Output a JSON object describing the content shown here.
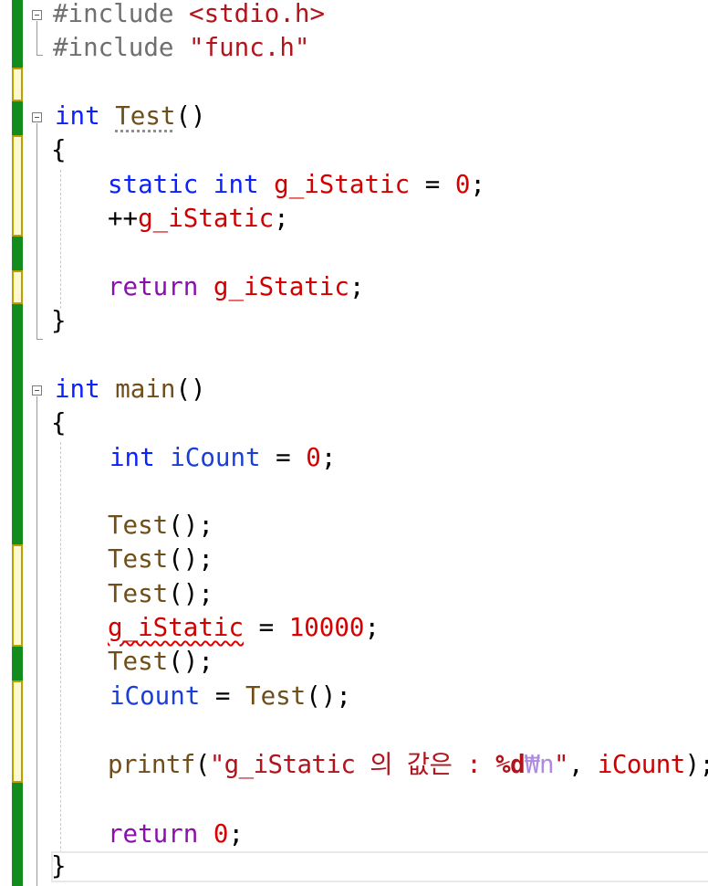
{
  "code": {
    "l01": {
      "hash": "#include",
      "space": " ",
      "path": "<stdio.h>"
    },
    "l02": {
      "hash": "#include",
      "space": " ",
      "path": "\"func.h\""
    },
    "l04": {
      "type": "int",
      "name": "Test",
      "parens": "()"
    },
    "l05": {
      "brace": "{"
    },
    "l06": {
      "static": "static",
      "int": "int",
      "var": "g_iStatic",
      "eq": " = ",
      "num": "0",
      "semi": ";"
    },
    "l07": {
      "op": "++",
      "var": "g_iStatic",
      "semi": ";"
    },
    "l09": {
      "ret": "return",
      "var": "g_iStatic",
      "semi": ";"
    },
    "l10": {
      "brace": "}"
    },
    "l12": {
      "type": "int",
      "name": "main",
      "parens": "()"
    },
    "l13": {
      "brace": "{"
    },
    "l14": {
      "int": "int",
      "var": "iCount",
      "eq": " = ",
      "num": "0",
      "semi": ";"
    },
    "l16": {
      "call": "Test",
      "tail": "();"
    },
    "l17": {
      "call": "Test",
      "tail": "();"
    },
    "l18": {
      "call": "Test",
      "tail": "();"
    },
    "l19": {
      "var": "g_iStatic",
      "eq": " = ",
      "num": "10000",
      "semi": ";"
    },
    "l20": {
      "call": "Test",
      "tail": "();"
    },
    "l21": {
      "var": "iCount",
      "eq": " = ",
      "call": "Test",
      "tail": "();"
    },
    "l23": {
      "fn": "printf",
      "open": "(",
      "str1": "\"g_iStatic 의 값은 : ",
      "fmt": "%d",
      "esc": "₩n",
      "str2": "\"",
      "comma": ", ",
      "var": "iCount",
      "close": ");"
    },
    "l25": {
      "ret": "return",
      "num": "0",
      "semi": ";"
    },
    "l26": {
      "brace": "}"
    }
  },
  "colors": {
    "keyword": "#0a22ff",
    "preprocessor": "#6f6f6f",
    "string": "#b3141c",
    "number": "#d70000",
    "function": "#6f4e19",
    "return": "#8a0fad",
    "change_saved": "#128c1c",
    "change_unsaved": "#fff7d0"
  }
}
